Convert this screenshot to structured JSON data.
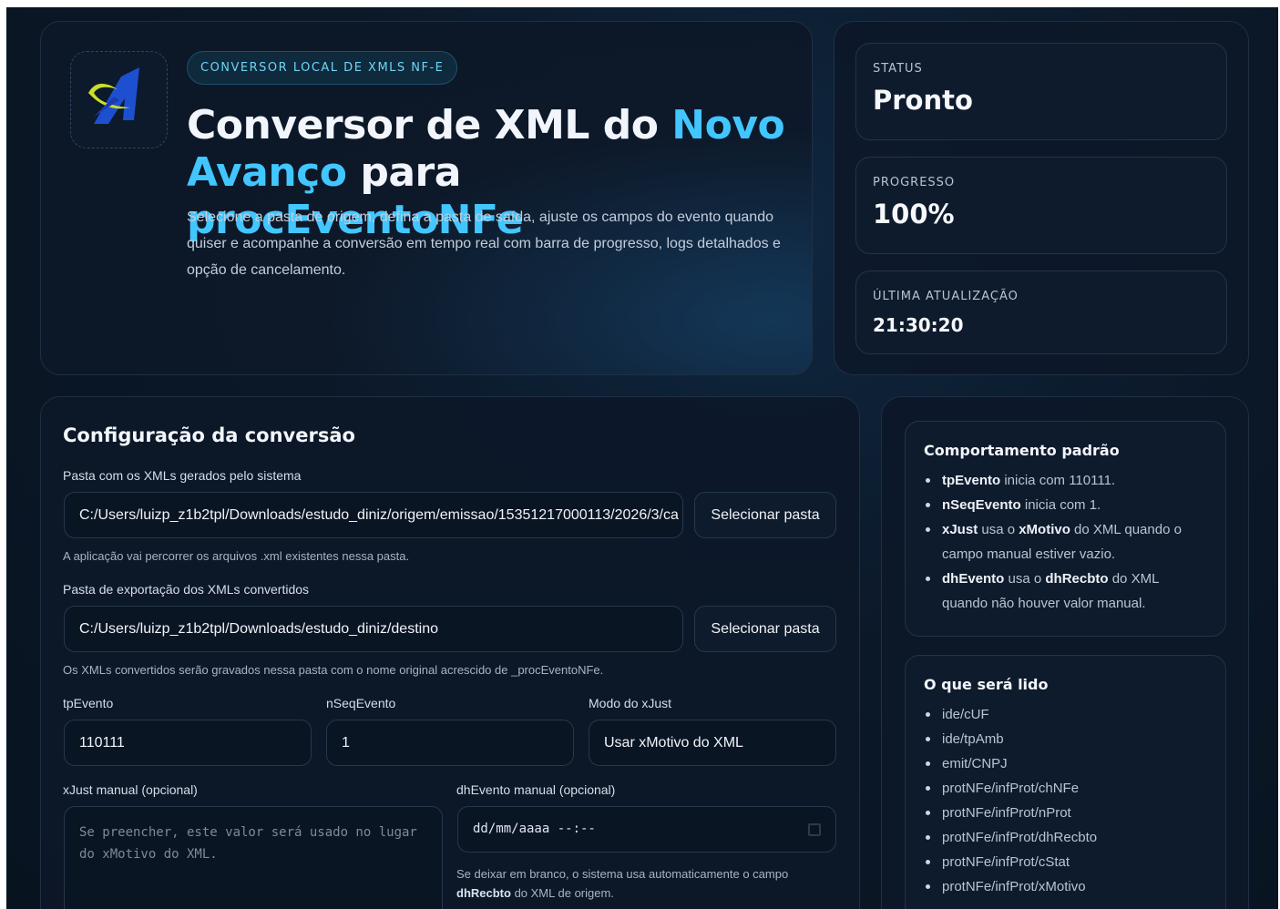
{
  "hero": {
    "tag": "CONVERSOR LOCAL DE XMLS NF-E",
    "title_parts": [
      "Conversor de XML do ",
      "Novo Avanço",
      " para ",
      "procEventoNFe"
    ],
    "description": "Selecione a pasta de origem, defina a pasta de saída, ajuste os campos do evento quando quiser e acompanhe a conversão em tempo real com barra de progresso, logs detalhados e opção de cancelamento."
  },
  "status": {
    "status_label": "STATUS",
    "status_value": "Pronto",
    "progress_label": "PROGRESSO",
    "progress_value": "100%",
    "progress_fraction": 1.0,
    "updated_label": "ÚLTIMA ATUALIZAÇÃO",
    "updated_value": "21:30:20"
  },
  "config": {
    "heading": "Configuração da conversão",
    "source_label": "Pasta com os XMLs gerados pelo sistema",
    "source_value": "C:/Users/luizp_z1b2tpl/Downloads/estudo_diniz/origem/emissao/15351217000113/2026/3/ca",
    "select_button": "Selecionar pasta",
    "source_hint": "A aplicação vai percorrer os arquivos .xml existentes nessa pasta.",
    "export_label": "Pasta de exportação dos XMLs convertidos",
    "export_value": "C:/Users/luizp_z1b2tpl/Downloads/estudo_diniz/destino",
    "export_hint": "Os XMLs convertidos serão gravados nessa pasta com o nome original acrescido de _procEventoNFe.",
    "tpEvento_label": "tpEvento",
    "tpEvento_value": "110111",
    "nSeq_label": "nSeqEvento",
    "nSeq_value": "1",
    "mode_label": "Modo do xJust",
    "mode_value": "Usar xMotivo do XML",
    "xjust_label": "xJust manual (opcional)",
    "xjust_placeholder": "Se preencher, este valor será usado no lugar do xMotivo do XML.",
    "dh_label": "dhEvento manual (opcional)",
    "dh_placeholder": "dd/mm/aaaa --:--",
    "dh_hint_pre": "Se deixar em branco, o sistema usa automaticamente o campo ",
    "dh_hint_bold": "dhRecbto",
    "dh_hint_post": " do XML de origem."
  },
  "defaults": {
    "heading": "Comportamento padrão",
    "items": [
      {
        "bold": "tpEvento",
        "text": " inicia com 110111."
      },
      {
        "bold": "nSeqEvento",
        "text": " inicia com 1."
      },
      {
        "bold": "xJust",
        "text": " usa o ",
        "bold2": "xMotivo",
        "text2": " do XML quando o campo manual estiver vazio."
      },
      {
        "bold": "dhEvento",
        "text": " usa o ",
        "bold2": "dhRecbto",
        "text2": " do XML quando não houver valor manual."
      }
    ]
  },
  "reads": {
    "heading": "O que será lido",
    "items": [
      "ide/cUF",
      "ide/tpAmb",
      "emit/CNPJ",
      "protNFe/infProt/chNFe",
      "protNFe/infProt/nProt",
      "protNFe/infProt/dhRecbto",
      "protNFe/infProt/cStat",
      "protNFe/infProt/xMotivo"
    ]
  },
  "colors": {
    "accent": "#42c6ff",
    "background": "#0b1828",
    "card_border": "#1f3044"
  }
}
